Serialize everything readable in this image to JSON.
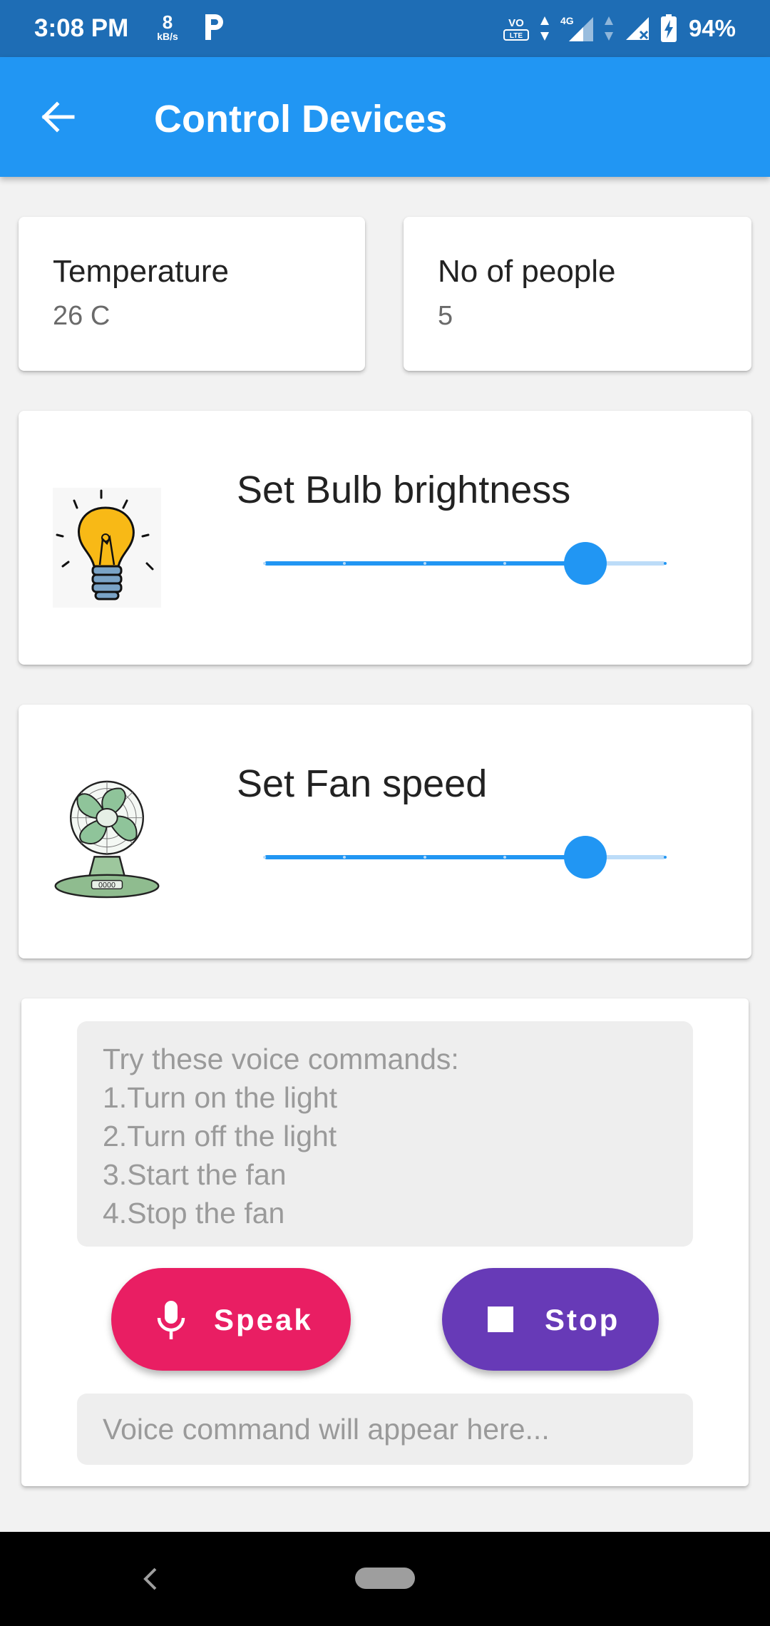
{
  "status_bar": {
    "time": "3:08 PM",
    "net_speed_value": "8",
    "net_speed_unit": "kB/s",
    "notification_icon": "p-icon",
    "volte_label_top": "VO",
    "volte_label_bottom": "LTE",
    "network_label": "4G",
    "battery_percent": "94%"
  },
  "app_bar": {
    "title": "Control Devices",
    "back_icon": "arrow-left-icon"
  },
  "sensors": {
    "temperature": {
      "label": "Temperature",
      "value": "26 C"
    },
    "people": {
      "label": "No of people",
      "value": "5"
    }
  },
  "controls": {
    "bulb": {
      "title": "Set Bulb brightness",
      "icon": "light-bulb-icon",
      "level_fraction": 0.8,
      "divisions": 5
    },
    "fan": {
      "title": "Set Fan speed",
      "icon": "fan-icon",
      "level_fraction": 0.8,
      "divisions": 5,
      "badge": "0000"
    }
  },
  "voice": {
    "hint_lines": [
      "Try these voice commands:",
      "1.Turn on the light",
      "2.Turn off the light",
      "3.Start the fan",
      "4.Stop the fan"
    ],
    "speak_label": "Speak",
    "speak_icon": "microphone-icon",
    "stop_label": "Stop",
    "stop_icon": "stop-square-icon",
    "output_placeholder": "Voice command will appear here...",
    "colors": {
      "speak": "#e91e63",
      "stop": "#673ab7"
    }
  },
  "theme": {
    "primary": "#2196f3",
    "status_bar": "#1e6db5"
  },
  "nav_bar": {
    "back_icon": "nav-back-icon",
    "home_icon": "nav-home-pill-icon"
  }
}
